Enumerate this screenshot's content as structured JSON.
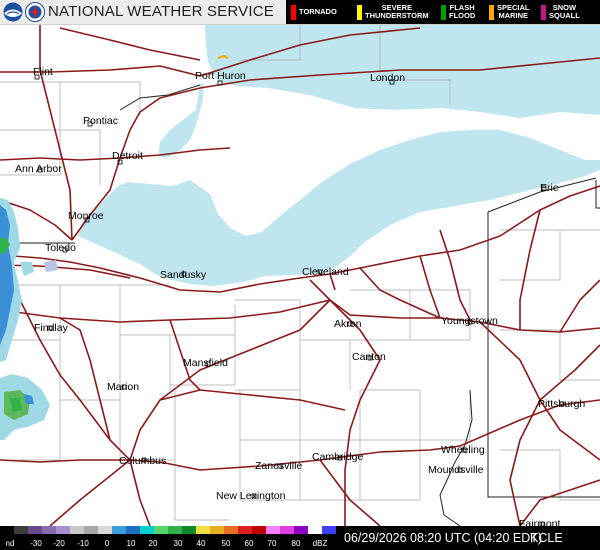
{
  "header": {
    "title": "NATIONAL WEATHER SERVICE",
    "logos": [
      "noaa-logo",
      "nws-logo"
    ],
    "legend": [
      {
        "label": "TORNADO",
        "color": "#ff0000"
      },
      {
        "label": "SEVERE\nTHUNDERSTORM",
        "color": "#ffff00"
      },
      {
        "label": "FLASH\nFLOOD",
        "color": "#00a000"
      },
      {
        "label": "SPECIAL\nMARINE",
        "color": "#ffa500"
      },
      {
        "label": "SNOW\nSQUALL",
        "color": "#c71585"
      }
    ]
  },
  "map": {
    "cities": [
      {
        "name": "Flint"
      },
      {
        "name": "Port Huron"
      },
      {
        "name": "London"
      },
      {
        "name": "Pontiac"
      },
      {
        "name": "Detroit"
      },
      {
        "name": "Ann Arbor"
      },
      {
        "name": "Monroe"
      },
      {
        "name": "Toledo"
      },
      {
        "name": "Sandusky"
      },
      {
        "name": "Cleveland"
      },
      {
        "name": "Erie"
      },
      {
        "name": "Findlay"
      },
      {
        "name": "Akron"
      },
      {
        "name": "Youngstown"
      },
      {
        "name": "Mansfield"
      },
      {
        "name": "Canton"
      },
      {
        "name": "Marion"
      },
      {
        "name": "Pittsburgh"
      },
      {
        "name": "Columbus"
      },
      {
        "name": "Zanesville"
      },
      {
        "name": "Cambridge"
      },
      {
        "name": "Wheeling"
      },
      {
        "name": "Moundsville"
      },
      {
        "name": "New Lexington"
      },
      {
        "name": "Fairmont"
      }
    ],
    "colors": {
      "water": "#bfe6ee",
      "roads": "#8b1a1a",
      "boundaries": "#9a9a9a"
    }
  },
  "footer": {
    "scale_labels": [
      "nd",
      "-30",
      "-20",
      "-10",
      "0",
      "10",
      "20",
      "30",
      "40",
      "50",
      "60",
      "70",
      "80",
      "dBZ"
    ],
    "timestamp": "06/29/2026 08:20 UTC (04:20 EDT)",
    "radar_id": "KCLE"
  }
}
